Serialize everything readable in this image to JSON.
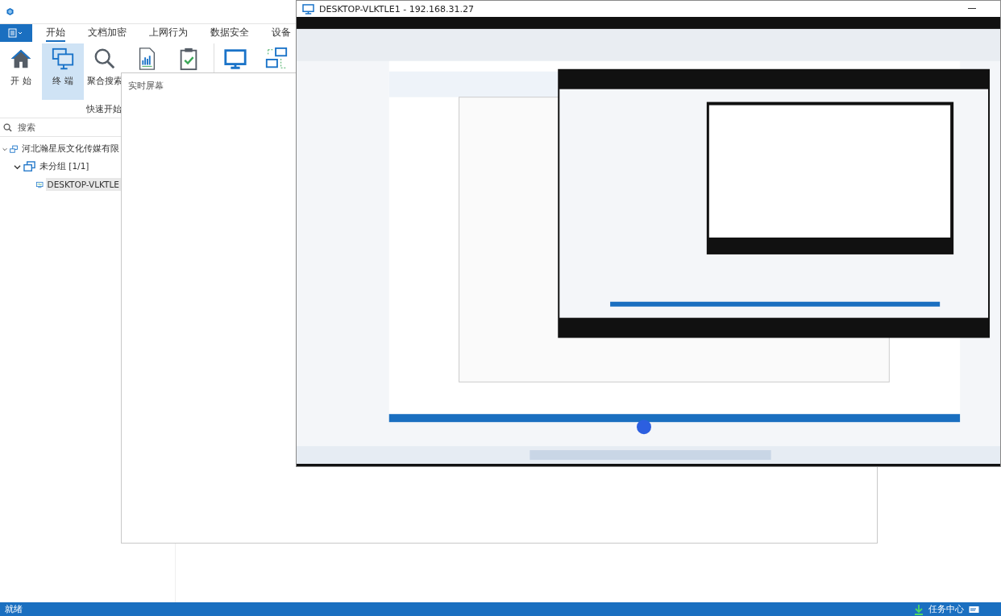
{
  "menu_tabs": [
    {
      "label": "开始",
      "selected": true
    },
    {
      "label": "文档加密",
      "selected": false
    },
    {
      "label": "上网行为",
      "selected": false
    },
    {
      "label": "数据安全",
      "selected": false
    },
    {
      "label": "设备",
      "selected": false
    }
  ],
  "ribbon": [
    {
      "kind": "home",
      "label": "开 始",
      "selected": false
    },
    {
      "kind": "terminal",
      "label": "终 端",
      "selected": true
    },
    {
      "kind": "search",
      "label": "聚合搜索",
      "selected": false
    },
    {
      "kind": "report",
      "selected": false
    },
    {
      "kind": "clipboard",
      "selected": false
    },
    {
      "kind": "monitor",
      "selected": false
    },
    {
      "kind": "network",
      "selected": false
    }
  ],
  "group_label": "快速开始",
  "search": {
    "placeholder": "搜索"
  },
  "tree": [
    {
      "label": "河北瀚星辰文化传媒有限",
      "kind": "org",
      "expanded": true,
      "children": [
        {
          "label": "未分组  [1/1]",
          "kind": "group",
          "expanded": true,
          "children": [
            {
              "label": "DESKTOP-VLKTLE",
              "kind": "device",
              "selected": true
            }
          ]
        }
      ]
    }
  ],
  "panel": {
    "title": "实时屏幕"
  },
  "remote_window": {
    "title": "DESKTOP-VLKTLE1 - 192.168.31.27"
  },
  "status_bar": {
    "text": "就绪",
    "task_center": "任务中心"
  }
}
